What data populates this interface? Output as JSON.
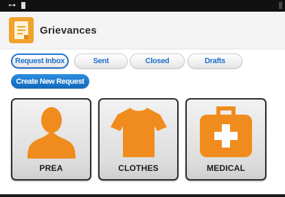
{
  "app": {
    "title": "Grievances",
    "accent_color": "#f0a22d",
    "link_color": "#1f6fcc"
  },
  "status_bar": {
    "icons": [
      "key-icon",
      "battery-icon"
    ]
  },
  "tabs": [
    {
      "label": "Request Inbox",
      "active": true
    },
    {
      "label": "Sent",
      "active": false
    },
    {
      "label": "Closed",
      "active": false
    },
    {
      "label": "Drafts",
      "active": false
    }
  ],
  "create_button": {
    "label": "Create New Request"
  },
  "categories": [
    {
      "label": "PREA",
      "icon": "person-icon"
    },
    {
      "label": "CLOTHES",
      "icon": "tshirt-icon"
    },
    {
      "label": "MEDICAL",
      "icon": "medical-kit-icon"
    }
  ]
}
